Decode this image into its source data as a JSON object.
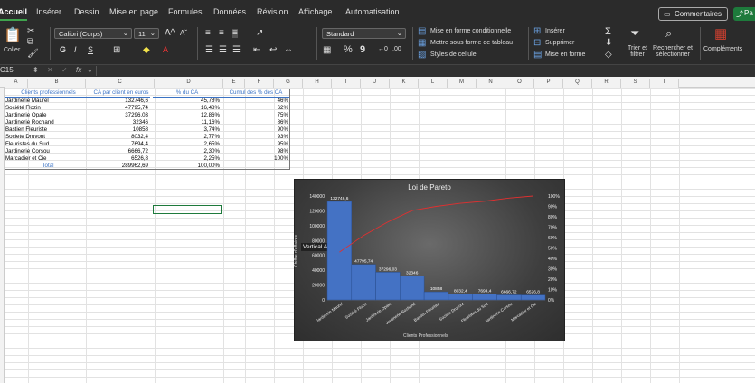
{
  "ribbon": {
    "tabs": [
      "Accueil",
      "Insérer",
      "Dessin",
      "Mise en page",
      "Formules",
      "Données",
      "Révision",
      "Affichage",
      "Automatisation"
    ],
    "comments_label": "Commentaires",
    "share_label": "Pa",
    "paste_label": "Coller",
    "font_name": "Calibri (Corps)",
    "font_size": "11",
    "number_format": "Standard",
    "percent_symbol": "%",
    "comma_symbol": "9",
    "cond_format": "Mise en forme conditionnelle",
    "table_format": "Mettre sous forme de tableau",
    "cell_styles": "Styles de cellule",
    "insert": "Insérer",
    "delete": "Supprimer",
    "format": "Mise en forme",
    "sort_filter": "Trier et filtrer",
    "find_select": "Rechercher et sélectionner",
    "addins": "Compléments",
    "font_grow": "A",
    "font_shrink": "A",
    "bold": "G",
    "italic": "I",
    "underline": "S",
    "font_color": "A"
  },
  "formula_bar": {
    "name_box": "C15",
    "fx": "fx"
  },
  "columns": [
    "A",
    "B",
    "C",
    "D",
    "E",
    "F",
    "G",
    "H",
    "I",
    "J",
    "K",
    "L",
    "M",
    "N",
    "O",
    "P",
    "Q",
    "R",
    "S",
    "T"
  ],
  "table": {
    "headers": [
      "Clients professionnels",
      "CA par client en euros",
      "% du CA",
      "Cumul des % des CA"
    ],
    "rows": [
      [
        "Jardinerie Maurel",
        "132746,6",
        "45,78%",
        "46%"
      ],
      [
        "Société Flozin",
        "47795,74",
        "16,48%",
        "62%"
      ],
      [
        "Jardinerie Opale",
        "37296,03",
        "12,86%",
        "75%"
      ],
      [
        "Jardinerie Rochand",
        "32346",
        "11,16%",
        "86%"
      ],
      [
        "Bastien Fleuriste",
        "10858",
        "3,74%",
        "90%"
      ],
      [
        "Societe Druvont",
        "8032,4",
        "2,77%",
        "93%"
      ],
      [
        "Fleuristes du Sud",
        "7694,4",
        "2,65%",
        "95%"
      ],
      [
        "Jardinerie Corsou",
        "6666,72",
        "2,30%",
        "98%"
      ],
      [
        "Marcadier et Cie",
        "6526,8",
        "2,25%",
        "100%"
      ]
    ],
    "total_label": "Total",
    "total_ca": "289962,69",
    "total_pct": "100,00%"
  },
  "chart_data": {
    "type": "bar",
    "title": "Loi de Pareto",
    "xlabel": "Clients Professionnels",
    "ylabel": "Chiffre d'affaires",
    "categories": [
      "Jardinerie Maurel",
      "Société Flozin",
      "Jardinerie Opale",
      "Jardinerie Rochand",
      "Bastien Fleuriste",
      "Societe Druvont",
      "Fleuristes du Sud",
      "Jardinerie Corsou",
      "Marcadier et Cie"
    ],
    "series": [
      {
        "values": [
          132746.6,
          47795.74,
          37296.03,
          32346,
          10858,
          8032.4,
          7694.4,
          6666.72,
          6526.8
        ],
        "color": "#4472c4"
      },
      {
        "values": [
          46,
          62,
          75,
          86,
          90,
          93,
          95,
          98,
          100
        ],
        "color": "#e03030"
      }
    ],
    "data_labels": [
      "132746,6",
      "47795,74",
      "37296,03",
      "32346",
      "10858",
      "8032,4",
      "7694,4",
      "6666,72",
      "6526,8"
    ],
    "ylim": [
      0,
      140000
    ],
    "y_ticks": [
      "0",
      "20000",
      "40000",
      "60000",
      "80000",
      "100000",
      "120000",
      "140000"
    ],
    "y2lim": [
      0,
      100
    ],
    "y2_ticks": [
      "0%",
      "10%",
      "20%",
      "30%",
      "40%",
      "50%",
      "60%",
      "70%",
      "80%",
      "90%",
      "100%"
    ],
    "tooltip": "Vertical Axe"
  }
}
